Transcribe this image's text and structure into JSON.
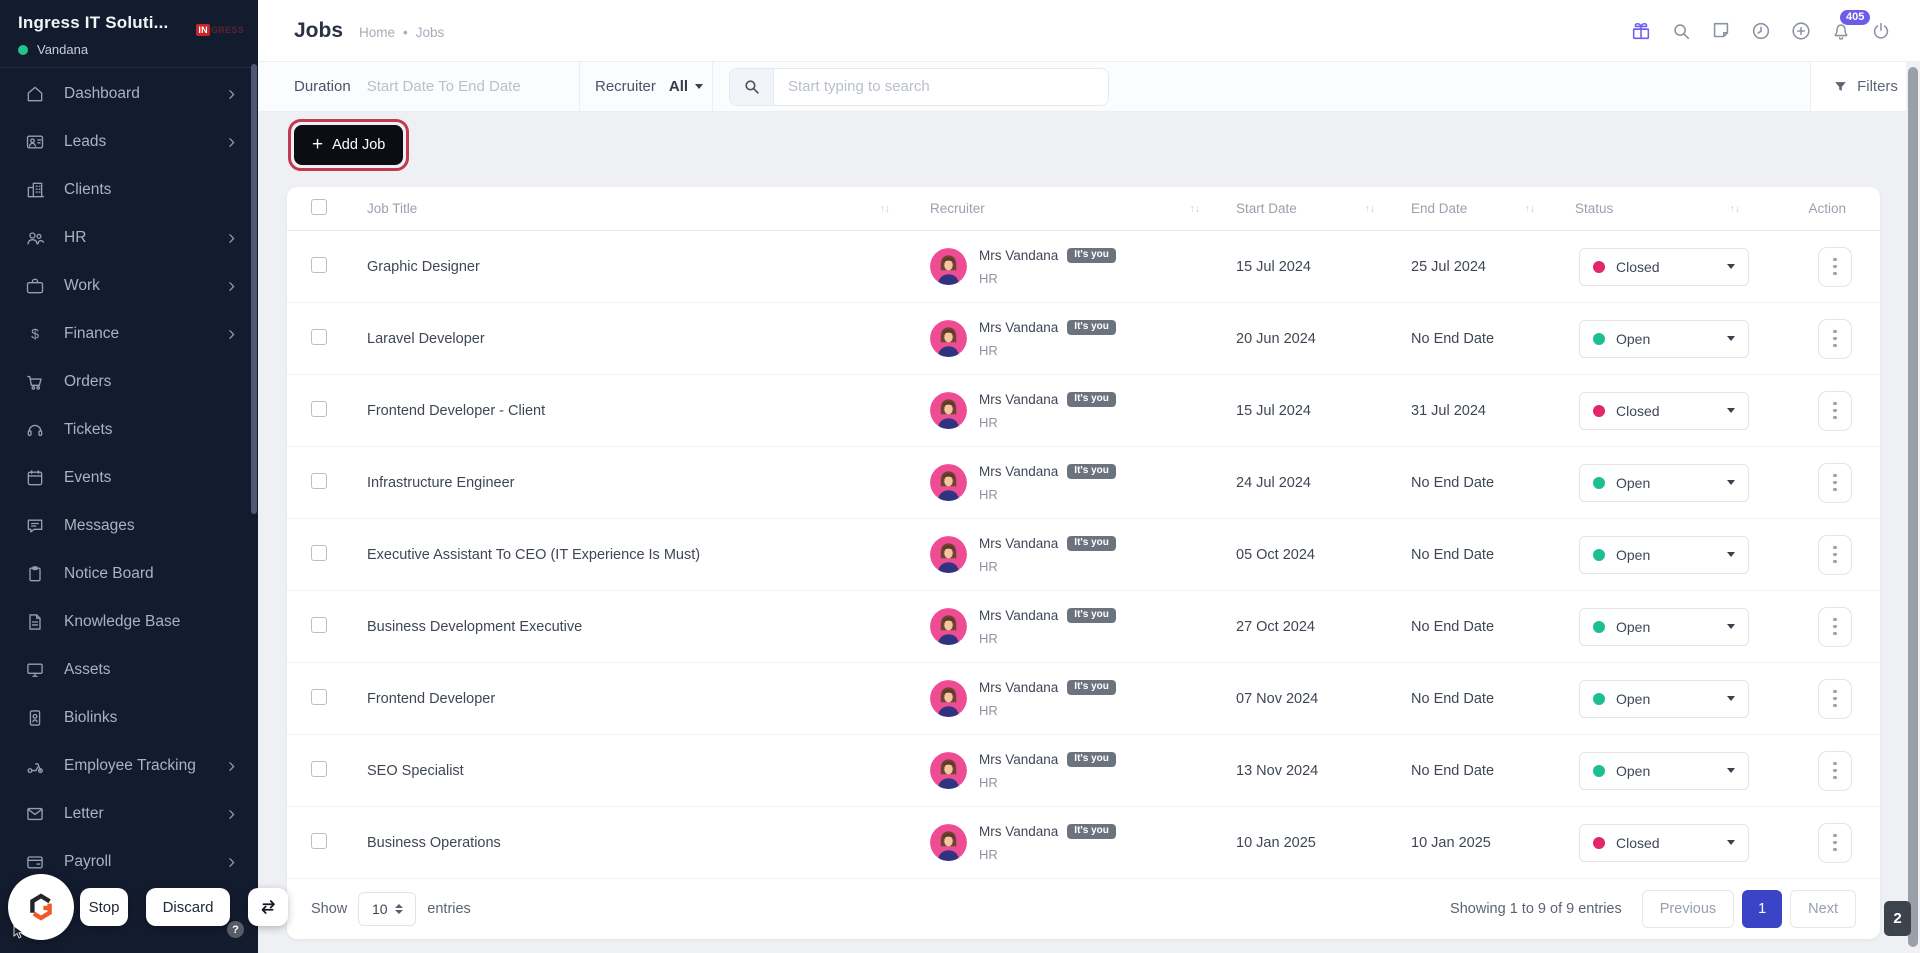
{
  "sidebar": {
    "workspace_name": "Ingress IT Soluti...",
    "user_name": "Vandana",
    "brand_badge": "IN",
    "brand_rest": "GRESS",
    "items": [
      {
        "label": "Dashboard",
        "icon": "dashboard",
        "has_chevron": true
      },
      {
        "label": "Leads",
        "icon": "leads",
        "has_chevron": true
      },
      {
        "label": "Clients",
        "icon": "clients",
        "has_chevron": false
      },
      {
        "label": "HR",
        "icon": "hr",
        "has_chevron": true
      },
      {
        "label": "Work",
        "icon": "work",
        "has_chevron": true
      },
      {
        "label": "Finance",
        "icon": "finance",
        "has_chevron": true
      },
      {
        "label": "Orders",
        "icon": "orders",
        "has_chevron": false
      },
      {
        "label": "Tickets",
        "icon": "tickets",
        "has_chevron": false
      },
      {
        "label": "Events",
        "icon": "events",
        "has_chevron": false
      },
      {
        "label": "Messages",
        "icon": "messages",
        "has_chevron": false
      },
      {
        "label": "Notice Board",
        "icon": "notice-board",
        "has_chevron": false
      },
      {
        "label": "Knowledge Base",
        "icon": "knowledge-base",
        "has_chevron": false
      },
      {
        "label": "Assets",
        "icon": "assets",
        "has_chevron": false
      },
      {
        "label": "Biolinks",
        "icon": "biolinks",
        "has_chevron": false
      },
      {
        "label": "Employee Tracking",
        "icon": "employee-tracking",
        "has_chevron": true
      },
      {
        "label": "Letter",
        "icon": "letter",
        "has_chevron": true
      },
      {
        "label": "Payroll",
        "icon": "payroll",
        "has_chevron": true
      }
    ]
  },
  "header": {
    "title": "Jobs",
    "breadcrumb_home": "Home",
    "breadcrumb_sep": "•",
    "breadcrumb_current": "Jobs",
    "notification_count": "405",
    "icons": [
      "gift",
      "search",
      "notes",
      "history",
      "add",
      "notifications",
      "power"
    ]
  },
  "filterbar": {
    "duration_label": "Duration",
    "duration_placeholder": "Start Date To End Date",
    "recruiter_label": "Recruiter",
    "recruiter_value": "All",
    "search_placeholder": "Start typing to search",
    "filters_label": "Filters"
  },
  "toolbar": {
    "add_job_label": "Add Job"
  },
  "table": {
    "columns": [
      "Job Title",
      "Recruiter",
      "Start Date",
      "End Date",
      "Status",
      "Action"
    ],
    "rows": [
      {
        "title": "Graphic Designer",
        "recruiter_name": "Mrs Vandana",
        "recruiter_badge": "It's you",
        "recruiter_role": "HR",
        "start_date": "15 Jul 2024",
        "end_date": "25 Jul 2024",
        "status": "Closed"
      },
      {
        "title": "Laravel Developer",
        "recruiter_name": "Mrs Vandana",
        "recruiter_badge": "It's you",
        "recruiter_role": "HR",
        "start_date": "20 Jun 2024",
        "end_date": "No End Date",
        "status": "Open"
      },
      {
        "title": "Frontend Developer - Client",
        "recruiter_name": "Mrs Vandana",
        "recruiter_badge": "It's you",
        "recruiter_role": "HR",
        "start_date": "15 Jul 2024",
        "end_date": "31 Jul 2024",
        "status": "Closed"
      },
      {
        "title": "Infrastructure Engineer",
        "recruiter_name": "Mrs Vandana",
        "recruiter_badge": "It's you",
        "recruiter_role": "HR",
        "start_date": "24 Jul 2024",
        "end_date": "No End Date",
        "status": "Open"
      },
      {
        "title": "Executive Assistant To CEO (IT Experience Is Must)",
        "recruiter_name": "Mrs Vandana",
        "recruiter_badge": "It's you",
        "recruiter_role": "HR",
        "start_date": "05 Oct 2024",
        "end_date": "No End Date",
        "status": "Open"
      },
      {
        "title": "Business Development Executive",
        "recruiter_name": "Mrs Vandana",
        "recruiter_badge": "It's you",
        "recruiter_role": "HR",
        "start_date": "27 Oct 2024",
        "end_date": "No End Date",
        "status": "Open"
      },
      {
        "title": "Frontend Developer",
        "recruiter_name": "Mrs Vandana",
        "recruiter_badge": "It's you",
        "recruiter_role": "HR",
        "start_date": "07 Nov 2024",
        "end_date": "No End Date",
        "status": "Open"
      },
      {
        "title": "SEO Specialist",
        "recruiter_name": "Mrs Vandana",
        "recruiter_badge": "It's you",
        "recruiter_role": "HR",
        "start_date": "13 Nov 2024",
        "end_date": "No End Date",
        "status": "Open"
      },
      {
        "title": "Business Operations",
        "recruiter_name": "Mrs Vandana",
        "recruiter_badge": "It's you",
        "recruiter_role": "HR",
        "start_date": "10 Jan 2025",
        "end_date": "10 Jan 2025",
        "status": "Closed"
      }
    ]
  },
  "pagination": {
    "show_label": "Show",
    "page_size": "10",
    "entries_label": "entries",
    "summary": "Showing 1 to 9 of 9 entries",
    "previous_label": "Previous",
    "current_page": "1",
    "next_label": "Next"
  },
  "overlay": {
    "stop_label": "Stop",
    "discard_label": "Discard",
    "help_label": "?",
    "corner_badge": "2"
  },
  "colors": {
    "sidebar_bg": "#131b2e",
    "accent_purple": "#6c5ce7",
    "status_open": "#1bbf92",
    "status_closed": "#e3256b",
    "highlight_ring": "#c23a50",
    "pagination_active": "#3b43c7",
    "add_button_bg": "#0c0d12"
  }
}
